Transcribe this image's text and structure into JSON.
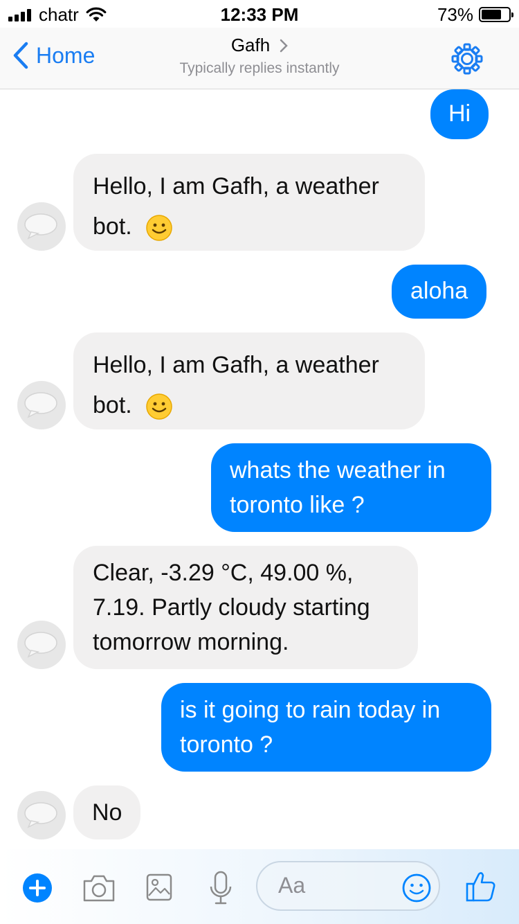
{
  "status_bar": {
    "carrier": "chatr",
    "time": "12:33 PM",
    "battery": "73%",
    "battery_level": 0.73
  },
  "nav": {
    "back_label": "Home",
    "title": "Gafh",
    "subtitle": "Typically replies instantly",
    "settings_icon": "gear-icon"
  },
  "messages": [
    {
      "from": "me",
      "lines": [
        "Hi"
      ]
    },
    {
      "from": "bot",
      "lines": [
        "Hello, I am Gafh, a weather",
        "bot."
      ],
      "emoji": "slightly-smiling-face"
    },
    {
      "from": "me",
      "lines": [
        "aloha"
      ]
    },
    {
      "from": "bot",
      "lines": [
        "Hello, I am Gafh, a weather",
        "bot."
      ],
      "emoji": "slightly-smiling-face"
    },
    {
      "from": "me",
      "lines": [
        "whats the weather in",
        "toronto like ?"
      ]
    },
    {
      "from": "bot",
      "lines": [
        "Clear, -3.29 °C, 49.00 %,",
        "7.19. Partly cloudy starting",
        "tomorrow morning."
      ]
    },
    {
      "from": "me",
      "lines": [
        "is it going to rain today in",
        "toronto ?"
      ]
    },
    {
      "from": "bot",
      "lines": [
        "No"
      ]
    }
  ],
  "composer": {
    "placeholder": "Aa",
    "icons": [
      "plus-icon",
      "camera-icon",
      "image-icon",
      "microphone-icon",
      "emoji-icon",
      "thumbs-up-icon"
    ]
  },
  "colors": {
    "accent": "#0084ff",
    "incoming_bubble": "#f1f0f0",
    "link_blue": "#1a7df2"
  }
}
